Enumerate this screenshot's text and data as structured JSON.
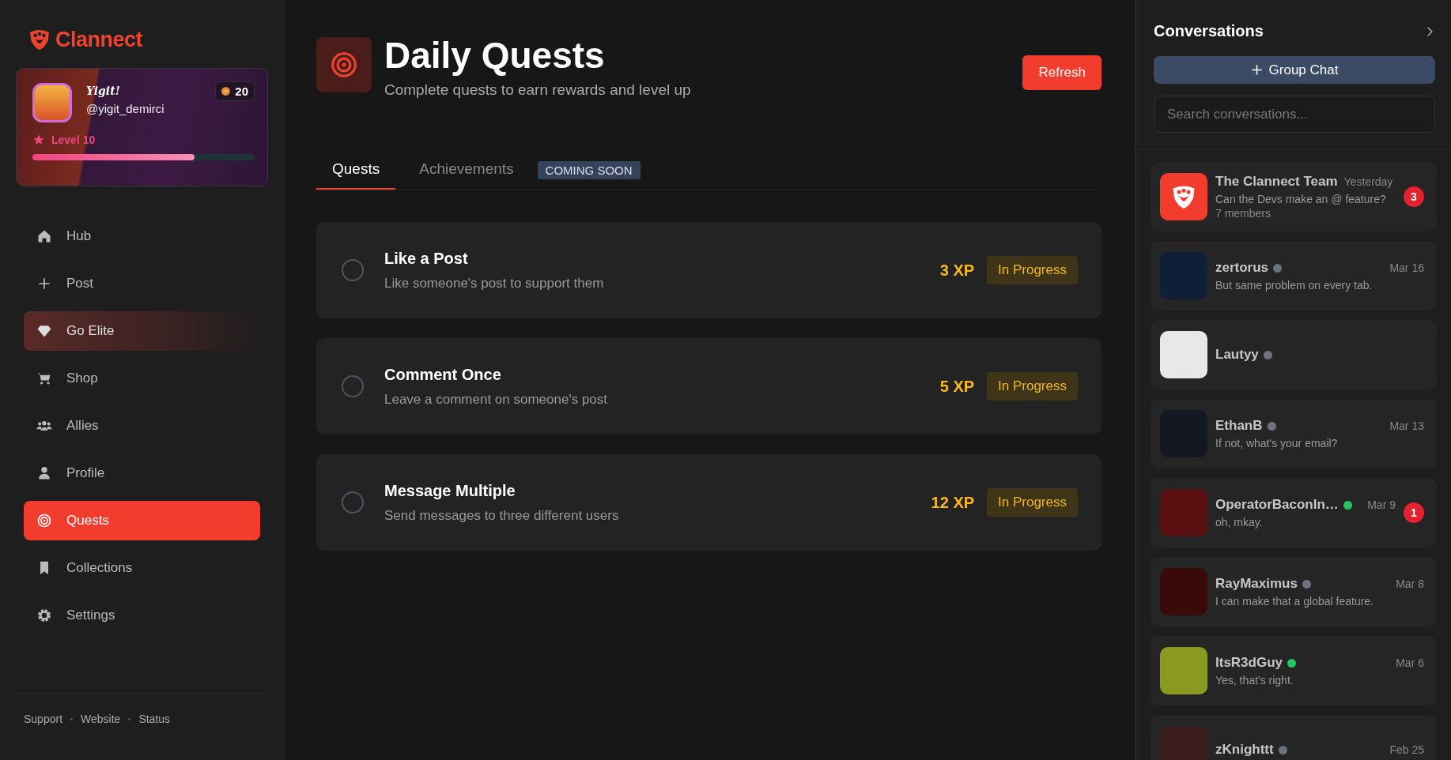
{
  "brand": {
    "name": "Clannect"
  },
  "profile": {
    "display_name": "Yigit!",
    "handle": "@yigit_demirci",
    "coins": "20",
    "level_label": "Level 10",
    "level": 0.73
  },
  "nav": [
    {
      "label": "Hub",
      "selected": false,
      "featured": false
    },
    {
      "label": "Post",
      "selected": false,
      "featured": false
    },
    {
      "label": "Go Elite",
      "selected": false,
      "featured": true
    },
    {
      "label": "Shop",
      "selected": false,
      "featured": false
    },
    {
      "label": "Allies",
      "selected": false,
      "featured": false
    },
    {
      "label": "Profile",
      "selected": false,
      "featured": false
    },
    {
      "label": "Quests",
      "selected": true,
      "featured": false
    },
    {
      "label": "Collections",
      "selected": false,
      "featured": false
    },
    {
      "label": "Settings",
      "selected": false,
      "featured": false
    }
  ],
  "footer_links": [
    "Support",
    "Website",
    "Status"
  ],
  "header": {
    "title": "Daily Quests",
    "subtitle": "Complete quests to earn rewards and level up",
    "refresh_button": "Refresh"
  },
  "tabs": [
    {
      "label": "Quests",
      "selected": true
    },
    {
      "label": "Achievements",
      "selected": false,
      "badge": "COMING SOON"
    }
  ],
  "quests": [
    {
      "title": "Like a Post",
      "description": "Like someone's post to support them",
      "xp": "3 XP",
      "status": "In Progress",
      "completed": false
    },
    {
      "title": "Comment Once",
      "description": "Leave a comment on someone's post",
      "xp": "5 XP",
      "status": "In Progress",
      "completed": false
    },
    {
      "title": "Message Multiple",
      "description": "Send messages to three different users",
      "xp": "12 XP",
      "status": "In Progress",
      "completed": false
    }
  ],
  "conversations_panel": {
    "title": "Conversations",
    "group_chat_button": "Group Chat",
    "search": {
      "placeholder": "Search conversations..."
    },
    "conversations": [
      {
        "kind": "group",
        "name": "The Clannect Team",
        "time": "Yesterday",
        "preview": "Can the Devs make an @ feature?",
        "members": "7 members",
        "unread": "3"
      },
      {
        "kind": "direct",
        "name": "zertorus",
        "online": false,
        "time": "Mar 16",
        "preview": "But same problem on every tab."
      },
      {
        "kind": "direct",
        "name": "Lautyy",
        "online": false
      },
      {
        "kind": "direct",
        "name": "EthanB",
        "online": false,
        "time": "Mar 13",
        "preview": "If not, what's your email?"
      },
      {
        "kind": "direct",
        "name": "OperatorBaconIn…",
        "online": true,
        "time": "Mar 9",
        "preview": "oh, mkay.",
        "unread": "1"
      },
      {
        "kind": "direct",
        "name": "RayMaximus",
        "online": false,
        "time": "Mar 8",
        "preview": "I can make that a global feature."
      },
      {
        "kind": "direct",
        "name": "ItsR3dGuy",
        "online": true,
        "time": "Mar 6",
        "preview": "Yes, that's right."
      },
      {
        "kind": "direct",
        "name": "zKnighttt",
        "online": false,
        "time": "Feb 25"
      }
    ]
  }
}
